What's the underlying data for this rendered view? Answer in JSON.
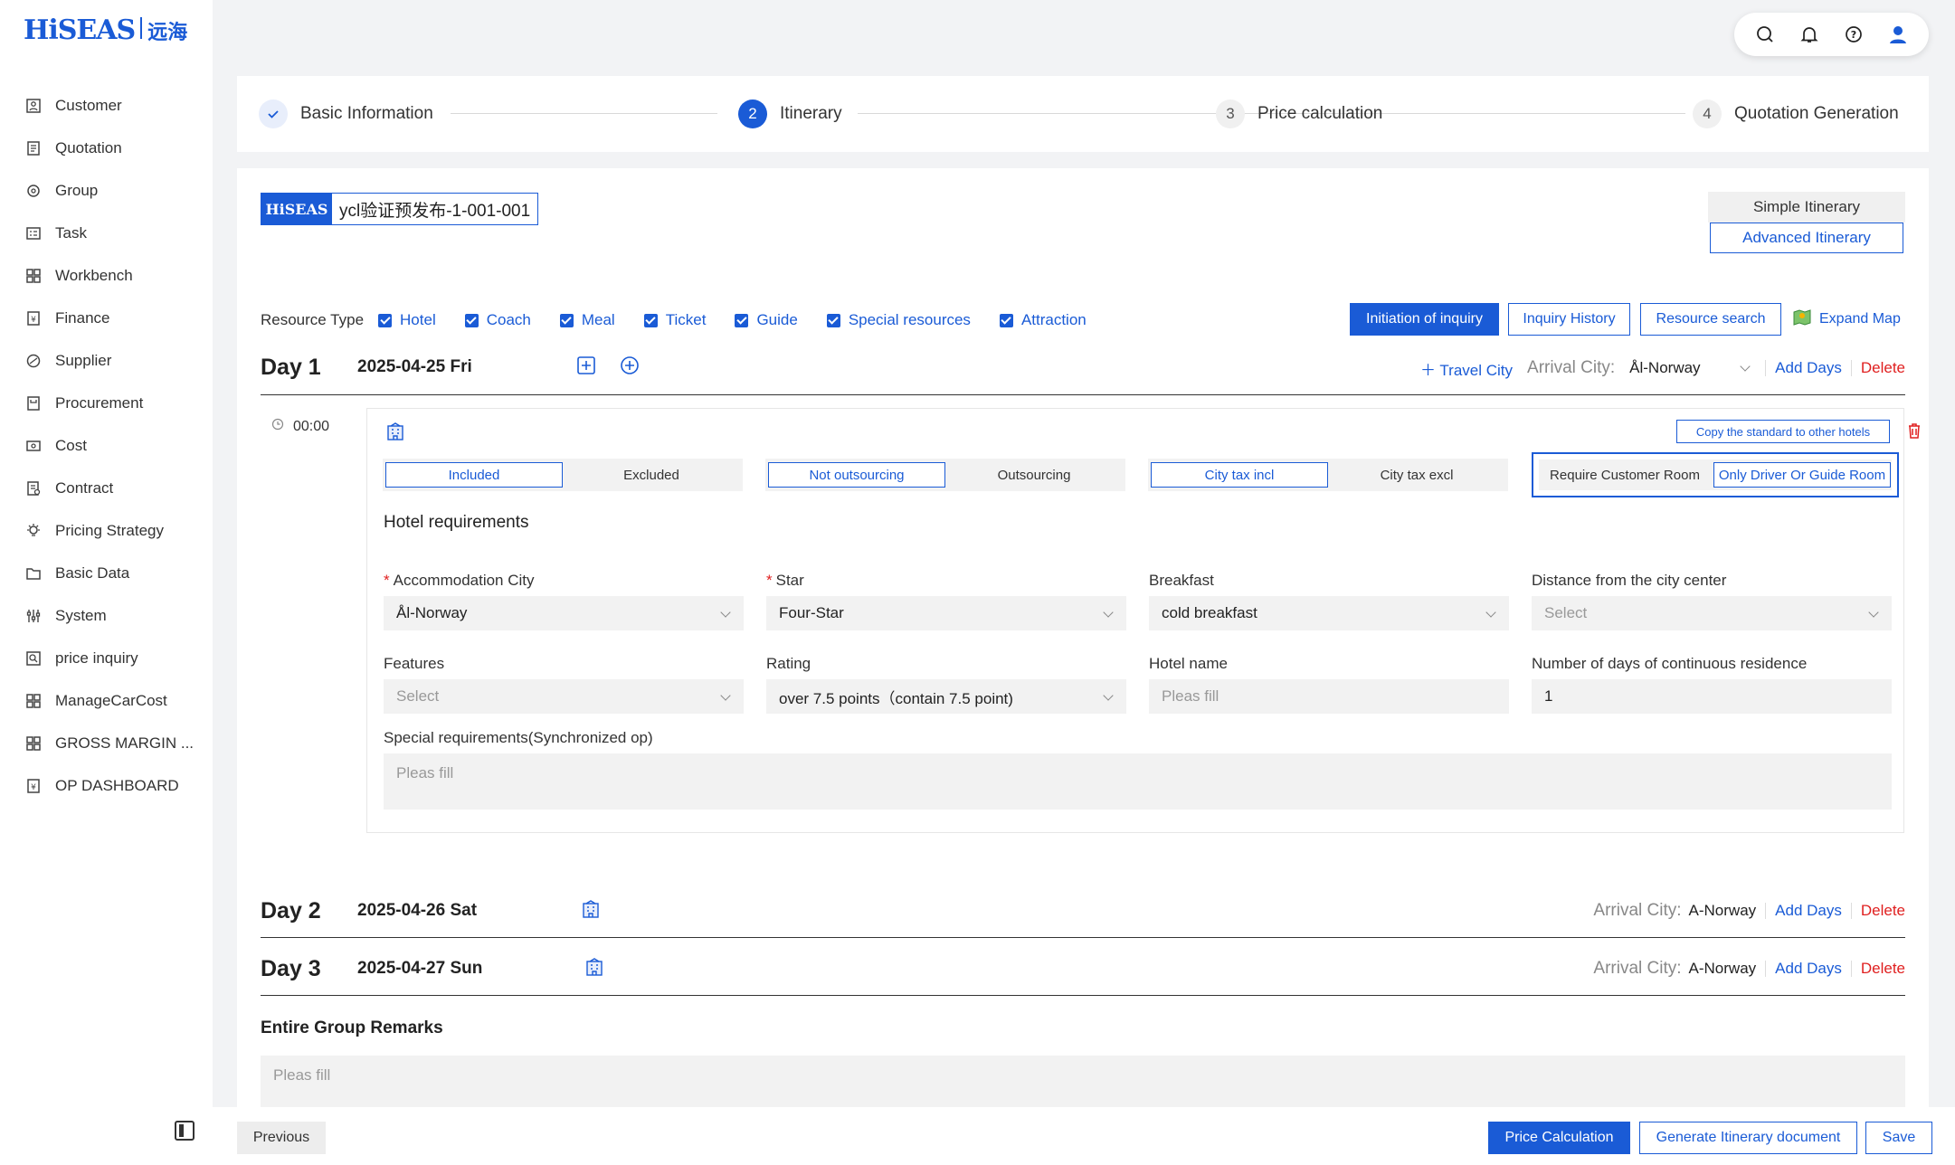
{
  "sidebar": {
    "logo_text": "HiSEAS",
    "logo_cn": "远海",
    "items": [
      {
        "label": "Customer",
        "icon": "customer-icon"
      },
      {
        "label": "Quotation",
        "icon": "quotation-icon"
      },
      {
        "label": "Group",
        "icon": "group-icon"
      },
      {
        "label": "Task",
        "icon": "task-icon"
      },
      {
        "label": "Workbench",
        "icon": "workbench-icon"
      },
      {
        "label": "Finance",
        "icon": "finance-icon"
      },
      {
        "label": "Supplier",
        "icon": "supplier-icon"
      },
      {
        "label": "Procurement",
        "icon": "procurement-icon"
      },
      {
        "label": "Cost",
        "icon": "cost-icon"
      },
      {
        "label": "Contract",
        "icon": "contract-icon"
      },
      {
        "label": "Pricing Strategy",
        "icon": "pricing-strategy-icon"
      },
      {
        "label": "Basic Data",
        "icon": "basic-data-icon"
      },
      {
        "label": "System",
        "icon": "system-icon"
      },
      {
        "label": "price inquiry",
        "icon": "price-inquiry-icon"
      },
      {
        "label": "ManageCarCost",
        "icon": "manage-car-cost-icon"
      },
      {
        "label": "GROSS MARGIN ...",
        "icon": "gross-margin-icon"
      },
      {
        "label": "OP DASHBOARD",
        "icon": "op-dashboard-icon"
      }
    ]
  },
  "steps": [
    {
      "num": "",
      "label": "Basic Information",
      "state": "done"
    },
    {
      "num": "2",
      "label": "Itinerary",
      "state": "active"
    },
    {
      "num": "3",
      "label": "Price calculation",
      "state": "todo"
    },
    {
      "num": "4",
      "label": "Quotation Generation",
      "state": "todo"
    }
  ],
  "header": {
    "badge": "HiSEAS",
    "title": "ycl验证预发布-1-001-001",
    "simple_itinerary": "Simple Itinerary",
    "advanced_itinerary": "Advanced Itinerary"
  },
  "resource": {
    "label": "Resource Type",
    "types": [
      "Hotel",
      "Coach",
      "Meal",
      "Ticket",
      "Guide",
      "Special resources",
      "Attraction"
    ],
    "initiation_inquiry": "Initiation of inquiry",
    "inquiry_history": "Inquiry History",
    "resource_search": "Resource search",
    "expand_map": "Expand Map"
  },
  "days": [
    {
      "name": "Day 1",
      "date": "2025-04-25 Fri",
      "arrival_label": "Arrival City:",
      "arrival_city": "Ål-Norway",
      "travel_city": "Travel City",
      "add_days": "Add Days",
      "delete": "Delete"
    },
    {
      "name": "Day 2",
      "date": "2025-04-26 Sat",
      "arrival_label": "Arrival City:",
      "arrival_city": "A-Norway",
      "add_days": "Add Days",
      "delete": "Delete"
    },
    {
      "name": "Day 3",
      "date": "2025-04-27 Sun",
      "arrival_label": "Arrival City:",
      "arrival_city": "A-Norway",
      "add_days": "Add Days",
      "delete": "Delete"
    }
  ],
  "hotel": {
    "time": "00:00",
    "copy_standard": "Copy the standard to other hotels",
    "seg1": [
      "Included",
      "Excluded"
    ],
    "seg2": [
      "Not outsourcing",
      "Outsourcing"
    ],
    "seg3": [
      "City tax incl",
      "City tax excl"
    ],
    "seg4": [
      "Require Customer Room",
      "Only Driver Or Guide Room"
    ],
    "section_title": "Hotel requirements",
    "accommodation_city_label": "Accommodation City",
    "accommodation_city": "Ål-Norway",
    "star_label": "Star",
    "star": "Four-Star",
    "breakfast_label": "Breakfast",
    "breakfast": "cold breakfast",
    "distance_label": "Distance from the city center",
    "distance_placeholder": "Select",
    "features_label": "Features",
    "features_placeholder": "Select",
    "rating_label": "Rating",
    "rating": "over 7.5 points（contain 7.5 point)",
    "hotel_name_label": "Hotel name",
    "hotel_name_placeholder": "Pleas fill",
    "continuous_label": "Number of days of continuous residence",
    "continuous_value": "1",
    "special_label": "Special requirements(Synchronized op)",
    "special_placeholder": "Pleas fill"
  },
  "remarks": {
    "title": "Entire Group Remarks",
    "placeholder": "Pleas fill"
  },
  "footer": {
    "previous": "Previous",
    "price_calculation": "Price Calculation",
    "generate_doc": "Generate Itinerary document",
    "save": "Save"
  },
  "colors": {
    "accent": "#1a5bd6",
    "danger": "#e02020"
  }
}
